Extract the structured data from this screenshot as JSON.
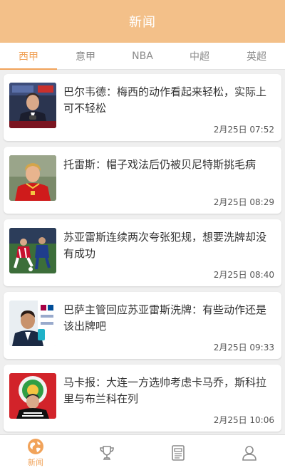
{
  "header": {
    "title": "新闻"
  },
  "tabs": [
    {
      "label": "西甲",
      "active": true
    },
    {
      "label": "意甲",
      "active": false
    },
    {
      "label": "NBA",
      "active": false
    },
    {
      "label": "中超",
      "active": false
    },
    {
      "label": "英超",
      "active": false
    }
  ],
  "news": [
    {
      "title": "巴尔韦德：梅西的动作看起来轻松，实际上可不轻松",
      "time": "2月25日 07:52",
      "thumb": "press-conference-photo"
    },
    {
      "title": "托雷斯：帽子戏法后仍被贝尼特斯挑毛病",
      "time": "2月25日 08:29",
      "thumb": "player-portrait-photo"
    },
    {
      "title": "苏亚雷斯连续两次夸张犯规，想要洗牌却没有成功",
      "time": "2月25日 08:40",
      "thumb": "match-action-photo"
    },
    {
      "title": "巴萨主管回应苏亚雷斯洗牌：有些动作还是该出牌吧",
      "time": "2月25日 09:33",
      "thumb": "official-interview-photo"
    },
    {
      "title": "马卡报：大连一方选帅考虑卡马乔，斯科拉里与布兰科在列",
      "time": "2月25日 10:06",
      "thumb": "coach-with-club-logo-photo"
    }
  ],
  "bottom_nav": [
    {
      "icon": "globe-icon",
      "label": "新闻",
      "active": true
    },
    {
      "icon": "trophy-icon",
      "active": false
    },
    {
      "icon": "newspaper-icon",
      "active": false
    },
    {
      "icon": "user-icon",
      "active": false
    }
  ],
  "colors": {
    "accent": "#f1a35a",
    "header_bg": "#f3c089",
    "inactive_icon": "#8a8a8a"
  }
}
